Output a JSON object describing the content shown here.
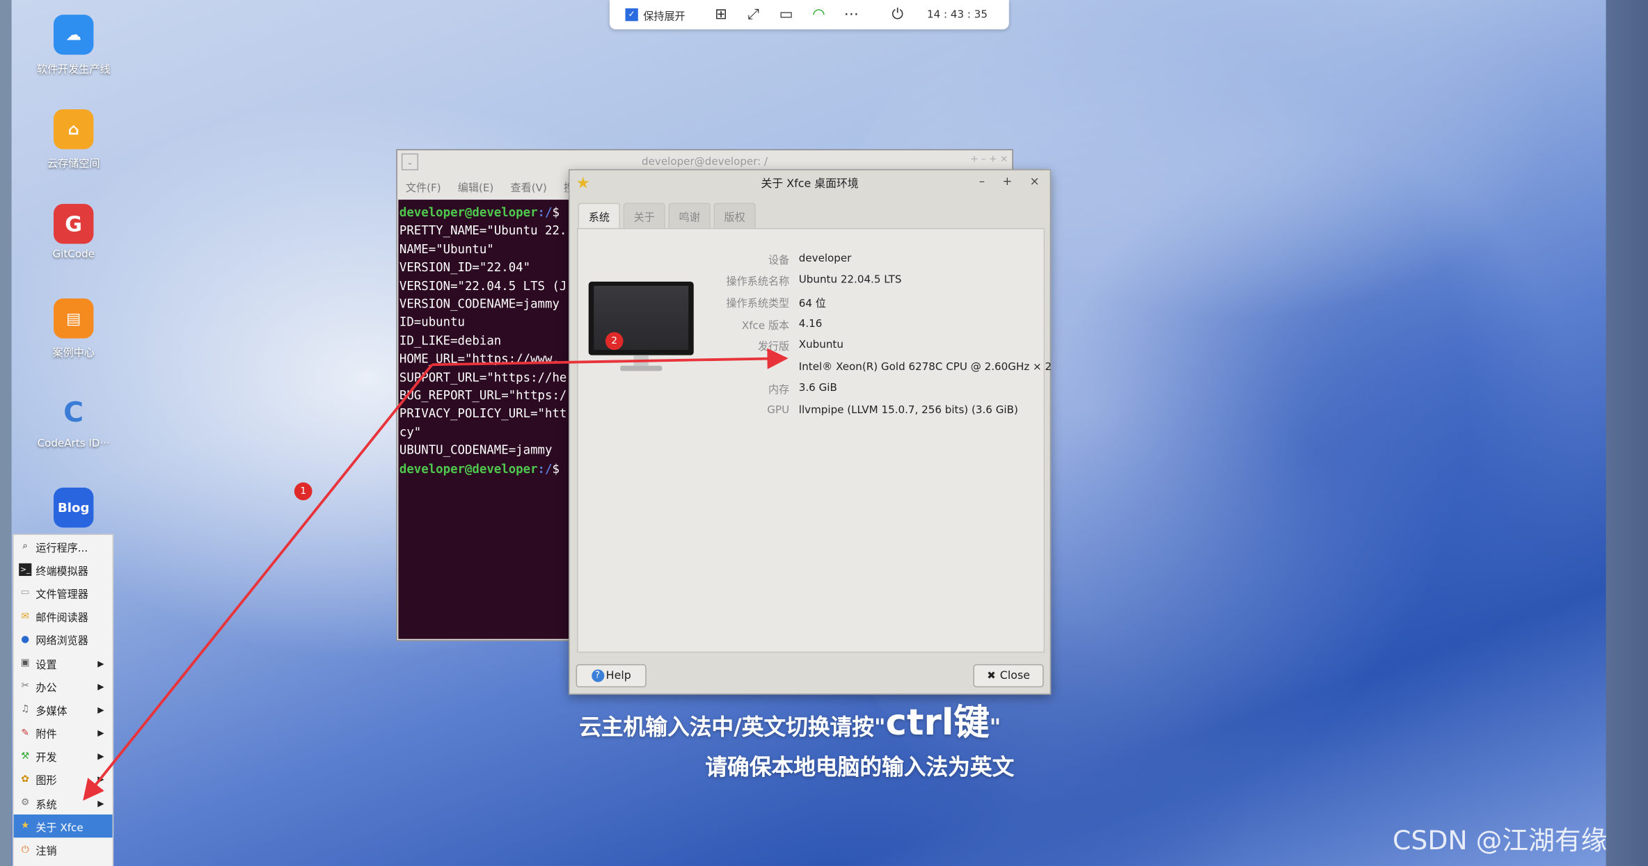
{
  "vm_toolbar": {
    "keep_expanded_label": "保持展开",
    "time": "14 : 43 : 35",
    "icons": [
      "add-icon",
      "fullscreen-icon",
      "monitor-icon",
      "wifi-icon",
      "more-icon",
      "power-icon"
    ]
  },
  "desktop_icons": [
    {
      "label": "软件开发生产线",
      "color": "#2f8ff0",
      "glyph": "☁"
    },
    {
      "label": "云存储空间",
      "color": "#f5a623",
      "glyph": "⌂"
    },
    {
      "label": "GitCode",
      "color": "#e23b3b",
      "glyph": "G"
    },
    {
      "label": "案例中心",
      "color": "#f58a1f",
      "glyph": "▤"
    },
    {
      "label": "CodeArts ID···",
      "color": "#3a7bd5",
      "glyph": "C"
    },
    {
      "label": "",
      "color": "#2a65e0",
      "glyph": "Blog"
    }
  ],
  "app_menu": {
    "items": [
      {
        "label": "运行程序...",
        "icon": "search-icon",
        "submenu": false
      },
      {
        "label": "终端模拟器",
        "icon": "terminal-icon",
        "submenu": false
      },
      {
        "label": "文件管理器",
        "icon": "folder-icon",
        "submenu": false
      },
      {
        "label": "邮件阅读器",
        "icon": "mail-icon",
        "submenu": false
      },
      {
        "label": "网络浏览器",
        "icon": "globe-icon",
        "submenu": false
      },
      {
        "label": "设置",
        "icon": "settings-icon",
        "submenu": true
      },
      {
        "label": "办公",
        "icon": "office-icon",
        "submenu": true
      },
      {
        "label": "多媒体",
        "icon": "multimedia-icon",
        "submenu": true
      },
      {
        "label": "附件",
        "icon": "accessories-icon",
        "submenu": true
      },
      {
        "label": "开发",
        "icon": "development-icon",
        "submenu": true
      },
      {
        "label": "图形",
        "icon": "graphics-icon",
        "submenu": true
      },
      {
        "label": "系统",
        "icon": "system-icon",
        "submenu": true
      },
      {
        "label": "关于 Xfce",
        "icon": "star-icon",
        "submenu": false,
        "active": true
      },
      {
        "label": "注销",
        "icon": "logout-icon",
        "submenu": false
      }
    ]
  },
  "terminal": {
    "title": "developer@developer: /",
    "menu": [
      "文件(F)",
      "编辑(E)",
      "查看(V)",
      "搜"
    ],
    "prompt_user": "developer@developer",
    "prompt_path": ":/",
    "prompt_symbol": "$",
    "lines": [
      "PRETTY_NAME=\"Ubuntu 22.",
      "NAME=\"Ubuntu\"",
      "VERSION_ID=\"22.04\"",
      "VERSION=\"22.04.5 LTS (J",
      "VERSION_CODENAME=jammy",
      "ID=ubuntu",
      "ID_LIKE=debian",
      "HOME_URL=\"https://www.",
      "SUPPORT_URL=\"https://he",
      "BUG_REPORT_URL=\"https:/",
      "PRIVACY_POLICY_URL=\"htt",
      "cy\"",
      "UBUNTU_CODENAME=jammy"
    ]
  },
  "about_dialog": {
    "title": "关于 Xfce 桌面环境",
    "tabs": [
      "系统",
      "关于",
      "鸣谢",
      "版权"
    ],
    "active_tab": 0,
    "info": [
      {
        "key": "设备",
        "value": "developer"
      },
      {
        "key": "操作系统名称",
        "value": "Ubuntu 22.04.5 LTS"
      },
      {
        "key": "操作系统类型",
        "value": "64 位"
      },
      {
        "key": "Xfce 版本",
        "value": "4.16"
      },
      {
        "key": "发行版",
        "value": "Xubuntu"
      },
      {
        "key": "",
        "value": "Intel® Xeon(R) Gold 6278C CPU @ 2.60GHz × 2"
      },
      {
        "key": "内存",
        "value": "3.6 GiB"
      },
      {
        "key": "GPU",
        "value": "llvmpipe (LLVM 15.0.7, 256 bits) (3.6 GiB)"
      }
    ],
    "help_label": "Help",
    "close_label": "Close"
  },
  "annotations": {
    "badge_1": "1",
    "badge_2": "2",
    "arrow_color": "#e8333a"
  },
  "captions": {
    "line1_prefix": "云主机输入法中/英文切换请按\"",
    "line1_key": "ctrl键",
    "line1_suffix": "\"",
    "line2": "请确保本地电脑的输入法为英文"
  },
  "watermark": "CSDN @江湖有缘"
}
